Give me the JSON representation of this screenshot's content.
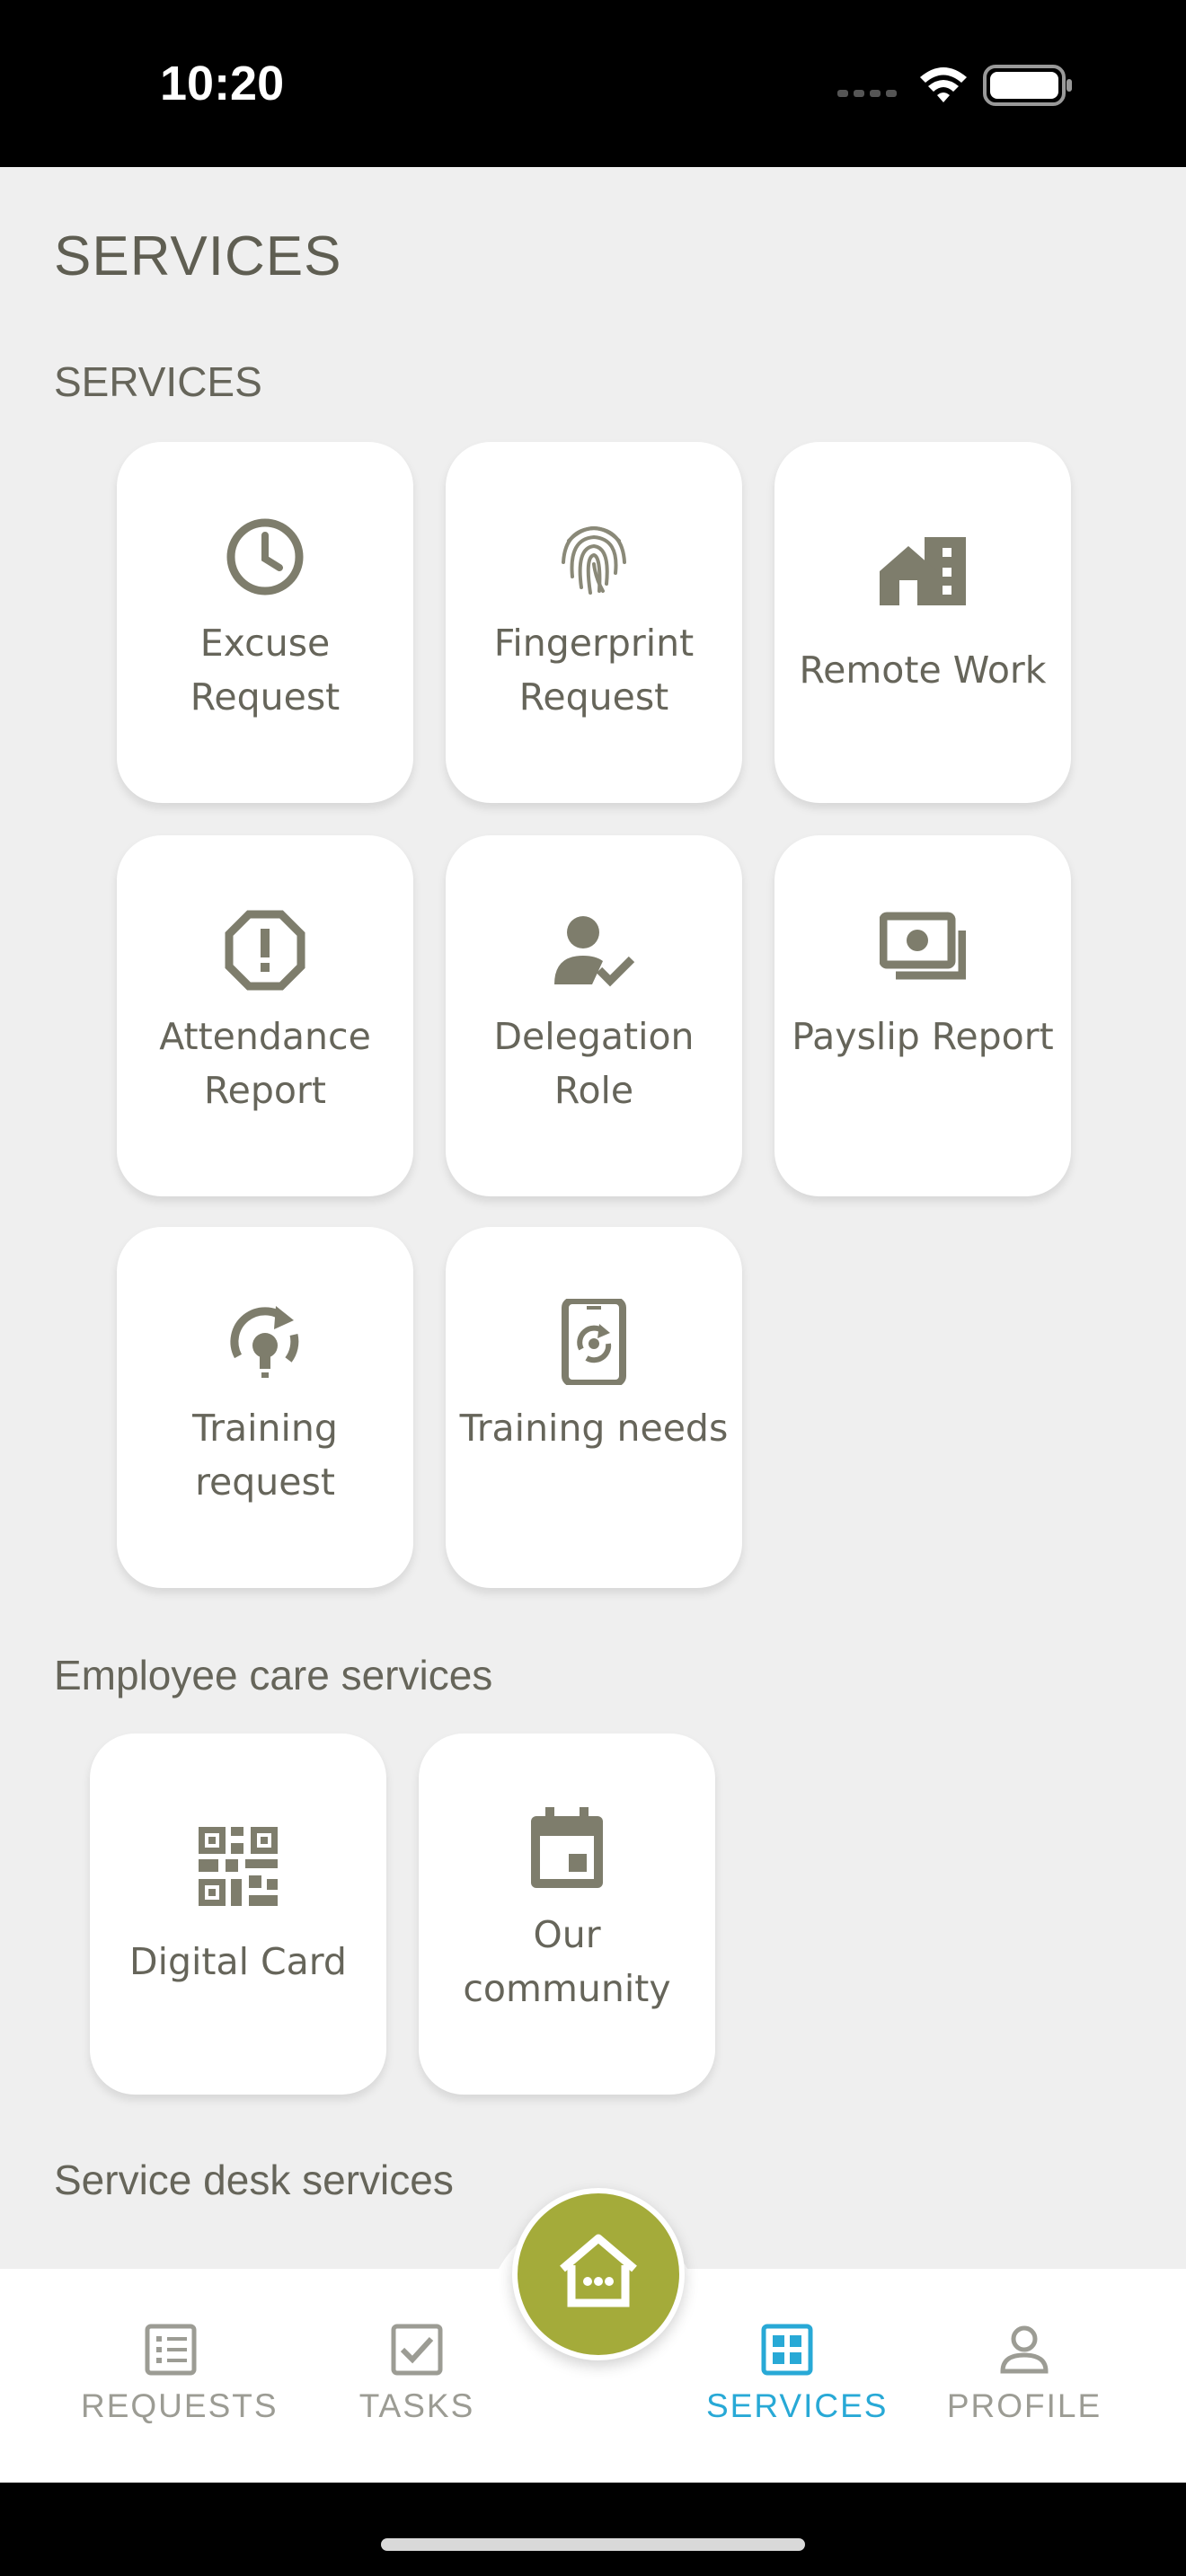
{
  "status_bar": {
    "time": "10:20"
  },
  "page_title": "SERVICES",
  "sections": {
    "services": {
      "heading": "SERVICES",
      "tiles": [
        {
          "label": "Excuse Request",
          "icon": "clock-icon"
        },
        {
          "label": "Fingerprint Request",
          "icon": "fingerprint-icon"
        },
        {
          "label": "Remote Work",
          "icon": "house-icon"
        },
        {
          "label": "Attendance Report",
          "icon": "alert-octagon-icon"
        },
        {
          "label": "Delegation Role",
          "icon": "person-check-icon"
        },
        {
          "label": "Payslip Report",
          "icon": "money-icon"
        },
        {
          "label": "Training request",
          "icon": "refresh-bulb-icon"
        },
        {
          "label": "Training needs",
          "icon": "tablet-refresh-icon"
        }
      ]
    },
    "employee_care": {
      "heading": "Employee care services",
      "tiles": [
        {
          "label": "Digital Card",
          "icon": "qr-code-icon"
        },
        {
          "label": "Our community",
          "icon": "calendar-icon"
        }
      ]
    },
    "service_desk": {
      "heading": "Service desk services"
    }
  },
  "bottom_nav": {
    "items": [
      {
        "label": "REQUESTS",
        "icon": "list-icon"
      },
      {
        "label": "TASKS",
        "icon": "checkbox-icon"
      },
      {
        "label": "SERVICES",
        "icon": "grid-icon",
        "active": true
      },
      {
        "label": "PROFILE",
        "icon": "person-icon"
      }
    ],
    "home_icon": "home-icon"
  },
  "colors": {
    "background": "#efefef",
    "icon": "#7e7d6c",
    "accent": "#a4ab3a",
    "active_nav": "#28a9d6"
  }
}
